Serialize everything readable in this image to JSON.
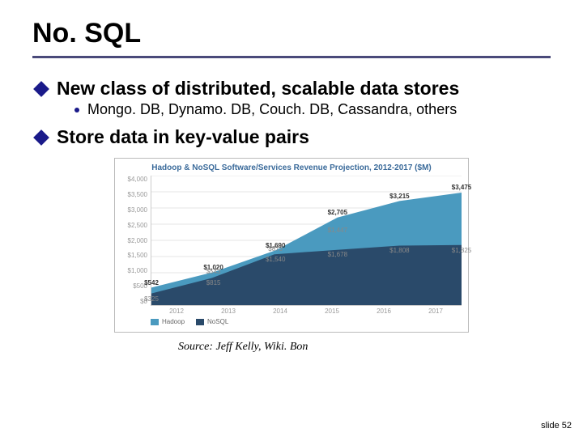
{
  "title": "No. SQL",
  "bullets": [
    {
      "text": "New class of distributed, scalable data stores",
      "sub": "Mongo. DB, Dynamo. DB, Couch. DB, Cassandra, others"
    },
    {
      "text": "Store data in key-value pairs",
      "sub": null
    }
  ],
  "chart_data": {
    "type": "area",
    "title": "Hadoop & NoSQL Software/Services Revenue Projection, 2012-2017 ($M)",
    "xlabel": "",
    "ylabel": "",
    "ylim": [
      0,
      4000
    ],
    "yticks": [
      0,
      500,
      1000,
      1500,
      2000,
      2500,
      3000,
      3500,
      4000
    ],
    "categories": [
      "2012",
      "2013",
      "2014",
      "2015",
      "2016",
      "2017"
    ],
    "series": [
      {
        "name": "Hadoop",
        "color": "#4a9abf",
        "values": [
          542,
          1020,
          1690,
          2705,
          3215,
          3475
        ]
      },
      {
        "name": "NoSQL",
        "color": "#2a4a6a",
        "values": [
          325,
          815,
          1540,
          1678,
          1808,
          1825
        ]
      }
    ],
    "mid_labels": [
      543,
      873,
      1447
    ]
  },
  "source": "Source: Jeff Kelly, Wiki. Bon",
  "slide_number": "slide 52"
}
